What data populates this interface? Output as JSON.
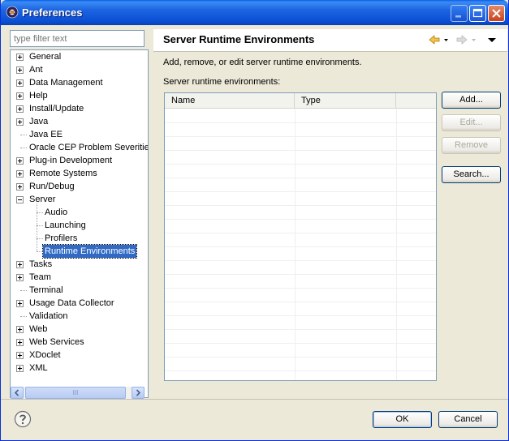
{
  "window": {
    "title": "Preferences"
  },
  "filter": {
    "placeholder": "type filter text"
  },
  "tree": [
    {
      "label": "General",
      "level": 0,
      "expander": "plus"
    },
    {
      "label": "Ant",
      "level": 0,
      "expander": "plus"
    },
    {
      "label": "Data Management",
      "level": 0,
      "expander": "plus"
    },
    {
      "label": "Help",
      "level": 0,
      "expander": "plus"
    },
    {
      "label": "Install/Update",
      "level": 0,
      "expander": "plus"
    },
    {
      "label": "Java",
      "level": 0,
      "expander": "plus"
    },
    {
      "label": "Java EE",
      "level": 0,
      "expander": "none"
    },
    {
      "label": "Oracle CEP Problem Severities",
      "level": 0,
      "expander": "none"
    },
    {
      "label": "Plug-in Development",
      "level": 0,
      "expander": "plus"
    },
    {
      "label": "Remote Systems",
      "level": 0,
      "expander": "plus"
    },
    {
      "label": "Run/Debug",
      "level": 0,
      "expander": "plus"
    },
    {
      "label": "Server",
      "level": 0,
      "expander": "minus"
    },
    {
      "label": "Audio",
      "level": 1,
      "expander": "none"
    },
    {
      "label": "Launching",
      "level": 1,
      "expander": "none"
    },
    {
      "label": "Profilers",
      "level": 1,
      "expander": "none"
    },
    {
      "label": "Runtime Environments",
      "level": 1,
      "expander": "none",
      "selected": true
    },
    {
      "label": "Tasks",
      "level": 0,
      "expander": "plus"
    },
    {
      "label": "Team",
      "level": 0,
      "expander": "plus"
    },
    {
      "label": "Terminal",
      "level": 0,
      "expander": "none"
    },
    {
      "label": "Usage Data Collector",
      "level": 0,
      "expander": "plus"
    },
    {
      "label": "Validation",
      "level": 0,
      "expander": "none"
    },
    {
      "label": "Web",
      "level": 0,
      "expander": "plus"
    },
    {
      "label": "Web Services",
      "level": 0,
      "expander": "plus"
    },
    {
      "label": "XDoclet",
      "level": 0,
      "expander": "plus"
    },
    {
      "label": "XML",
      "level": 0,
      "expander": "plus"
    }
  ],
  "scrollbar": {
    "thumb_grip": "III"
  },
  "page": {
    "title": "Server Runtime Environments",
    "description": "Add, remove, or edit server runtime environments.",
    "list_label": "Server runtime environments:",
    "columns": [
      "Name",
      "Type"
    ],
    "rows": []
  },
  "buttons": {
    "add": "Add...",
    "edit": "Edit...",
    "remove": "Remove",
    "search": "Search...",
    "ok": "OK",
    "cancel": "Cancel"
  },
  "icons": {
    "app": "eclipse-icon",
    "back": "back-arrow-icon",
    "forward": "forward-arrow-icon",
    "menu": "view-menu-icon",
    "help": "help-icon"
  },
  "colors": {
    "selection": "#316ac5",
    "titlebar": "#0a4fd4",
    "back_arrow": "#e6a21a"
  }
}
